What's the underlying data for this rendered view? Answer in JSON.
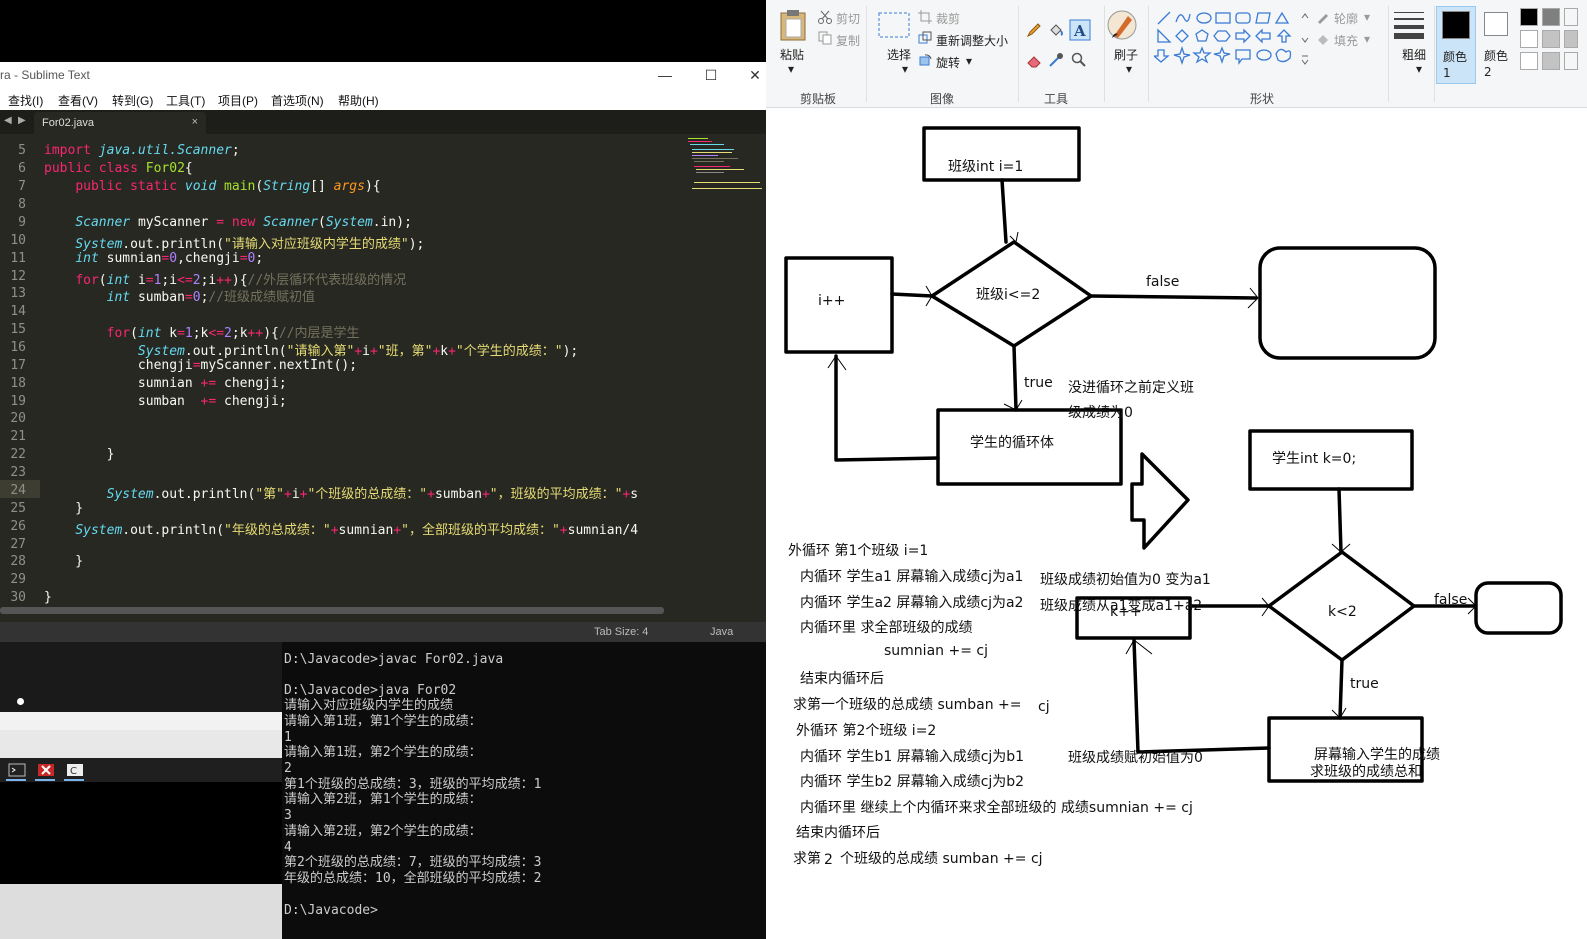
{
  "sublime": {
    "title": "ra - Sublime Text",
    "window_buttons": {
      "minimize": "—",
      "maximize": "☐",
      "close": "✕"
    },
    "menu": [
      "查找(I)",
      "查看(V)",
      "转到(G)",
      "工具(T)",
      "项目(P)",
      "首选项(N)",
      "帮助(H)"
    ],
    "tab": {
      "label": "For02.java",
      "close": "×"
    },
    "nav": {
      "left": "◀",
      "right": "▶"
    },
    "gutter": [
      "5",
      "6",
      "7",
      "8",
      "9",
      "10",
      "11",
      "12",
      "13",
      "14",
      "15",
      "16",
      "17",
      "18",
      "19",
      "20",
      "21",
      "22",
      "23",
      "24",
      "25",
      "26",
      "27",
      "28",
      "29",
      "30"
    ],
    "status": {
      "tab_size": "Tab Size: 4",
      "language": "Java"
    }
  },
  "cmd": {
    "lines": [
      "D:\\Javacode>javac For02.java",
      "",
      "D:\\Javacode>java For02",
      "请输入对应班级内学生的成绩",
      "请输入第1班，第1个学生的成绩：",
      "1",
      "请输入第1班，第2个学生的成绩：",
      "2",
      "第1个班级的总成绩：3，班级的平均成绩：1",
      "请输入第2班，第1个学生的成绩：",
      "3",
      "请输入第2班，第2个学生的成绩：",
      "4",
      "第2个班级的总成绩：7，班级的平均成绩：3",
      "年级的总成绩：10，全部班级的平均成绩：2",
      "",
      "D:\\Javacode>"
    ]
  },
  "paint": {
    "clipboard": {
      "paste": "粘贴",
      "cut": "剪切",
      "copy": "复制",
      "group": "剪贴板"
    },
    "image": {
      "select": "选择",
      "crop": "裁剪",
      "resize": "重新调整大小",
      "rotate": "旋转",
      "group": "图像"
    },
    "tools": {
      "group": "工具"
    },
    "brush": {
      "label": "刷子"
    },
    "shapes": {
      "outline": "轮廓",
      "fill": "填充",
      "group": "形状"
    },
    "size": {
      "label": "粗细"
    },
    "color1": {
      "label": "颜色 1",
      "value": "#000000"
    },
    "color2": {
      "label": "颜色 2",
      "value": "#ffffff"
    },
    "palette": [
      "#000000",
      "#7f7f7f",
      "#ffffff",
      "#c3c3c3",
      "#ffffff",
      "#c3c3c3"
    ]
  },
  "flowchart": {
    "init1": "班级int i=1",
    "cond1": "班级i<=2",
    "inc1": "i++",
    "body1": "学生的循环体",
    "false1": "false",
    "true1": "true",
    "note1a": "没进循环之前定义班",
    "note1b": "级成绩为0",
    "init2": "学生int k=0;",
    "cond2": "k<2",
    "inc2": "k++",
    "body2a": "屏幕输入学生的成绩",
    "body2b": "求班级的成绩总和",
    "false2": "false",
    "true2": "true",
    "note2": "班级成绩赋初始值为0"
  },
  "notes": [
    "外循环 第1个班级 i=1",
    "内循环 学生a1 屏幕输入成绩cj为a1",
    "内循环 学生a2 屏幕输入成绩cj为a2",
    "内循环里  求全部班级的成绩",
    "sumnian += cj",
    "结束内循环后",
    "求第一个班级的总成绩 sumban +=",
    "cj",
    "外循环 第2个班级 i=2",
    "内循环 学生b1 屏幕输入成绩cj为b1",
    "内循环 学生b2 屏幕输入成绩cj为b2",
    "内循环里  继续上个内循环来求全部班级的  成绩sumnian += cj",
    "结束内循环后",
    "求第",
    "2",
    "个班级的总成绩 sumban +=  cj",
    "班级成绩初始值为0 变为a1",
    "班级成绩从a1变成a1+a2"
  ]
}
